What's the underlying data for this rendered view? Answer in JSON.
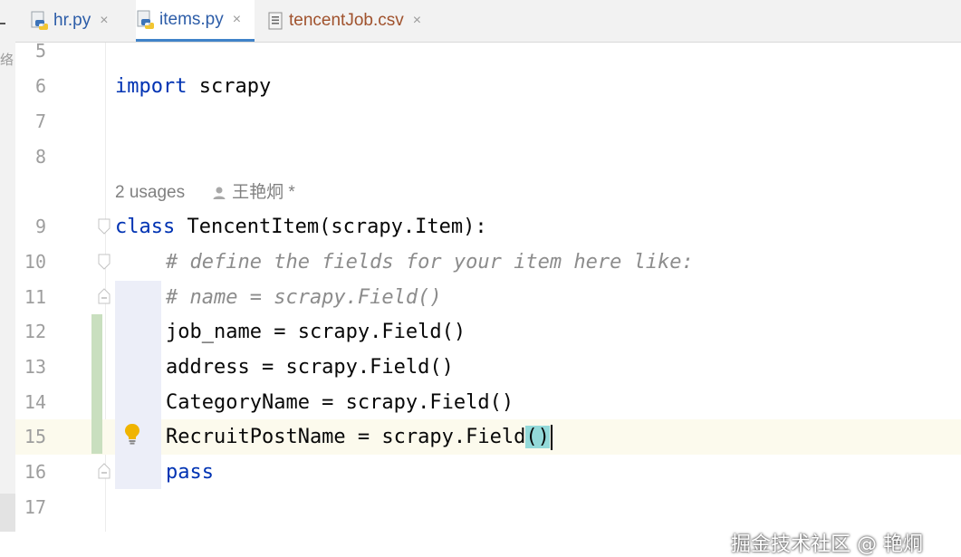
{
  "left_strip": {
    "stray_char": "络"
  },
  "tabs": [
    {
      "label": "hr.py",
      "icon": "python-file-icon",
      "color": "#2d5da8",
      "active": false
    },
    {
      "label": "items.py",
      "icon": "python-file-icon",
      "color": "#2d5da8",
      "active": true
    },
    {
      "label": "tencentJob.csv",
      "icon": "csv-file-icon",
      "color": "#a0522d",
      "active": false
    }
  ],
  "tab_close_glyph": "×",
  "inlay_hint": {
    "usages": "2 usages",
    "author": "王艳炯 *"
  },
  "lines": [
    {
      "num": "5",
      "code": ""
    },
    {
      "num": "6",
      "keyword": "import",
      "rest": " scrapy"
    },
    {
      "num": "7",
      "code": ""
    },
    {
      "num": "8",
      "code": ""
    },
    {
      "num": "9",
      "keyword": "class",
      "rest": " TencentItem(scrapy.Item):"
    },
    {
      "num": "10",
      "comment": "# define the fields for your item here like:"
    },
    {
      "num": "11",
      "comment": "# name = scrapy.Field()"
    },
    {
      "num": "12",
      "code": "job_name = scrapy.Field()"
    },
    {
      "num": "13",
      "code": "address = scrapy.Field()"
    },
    {
      "num": "14",
      "code": "CategoryName = scrapy.Field()"
    },
    {
      "num": "15",
      "code_before": "RecruitPostName = scrapy.Field",
      "paren": "()"
    },
    {
      "num": "16",
      "keyword": "pass"
    },
    {
      "num": "17",
      "code": ""
    }
  ],
  "watermark": "掘金技术社区 @ 艳炯",
  "colors": {
    "keyword": "#0033b3",
    "comment": "#8c8c8c",
    "current_line": "#fcfaed",
    "paren_highlight": "#93d9d9",
    "vcs_added": "#c9dfbf",
    "tab_underline": "#4083c9"
  }
}
